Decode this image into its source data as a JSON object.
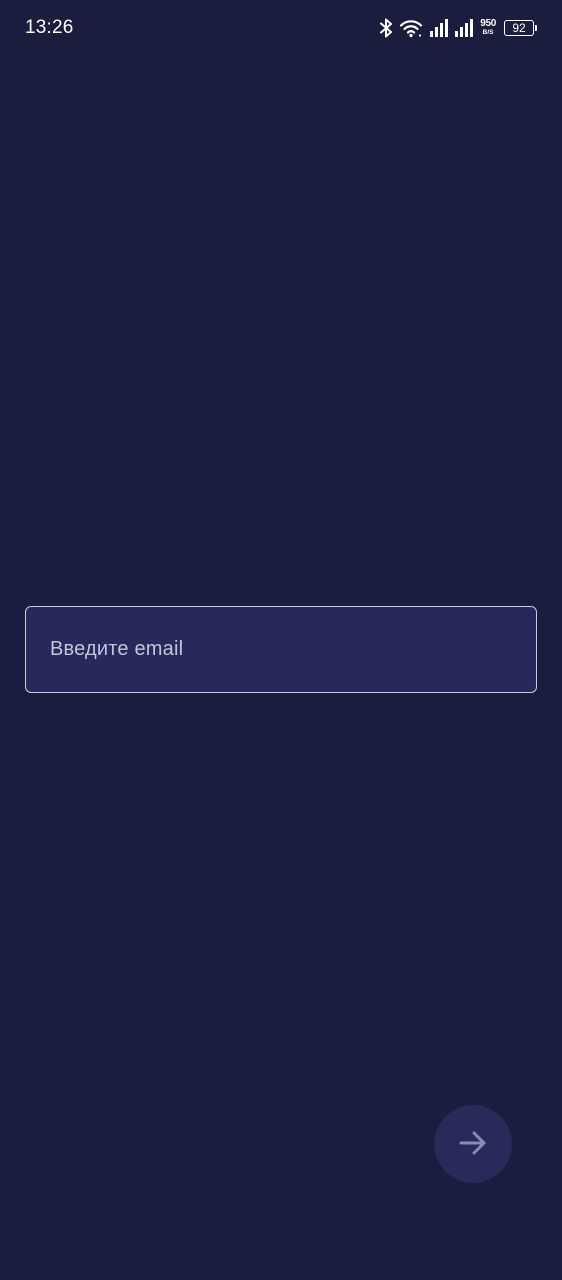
{
  "status_bar": {
    "time": "13:26",
    "net_speed_value": "950",
    "net_speed_unit": "B/S",
    "battery_level": "92",
    "icons": [
      "bluetooth-icon",
      "wifi-icon",
      "signal-icon",
      "signal-icon",
      "battery-icon"
    ]
  },
  "email_input": {
    "placeholder": "Введите email",
    "value": ""
  },
  "next_button": {
    "icon": "arrow-right-icon"
  },
  "colors": {
    "background": "#1b1d3f",
    "field_background": "#28295a",
    "field_border": "#c9cae0",
    "fab_background": "#292a5a",
    "fab_icon": "#8a8bb3"
  }
}
